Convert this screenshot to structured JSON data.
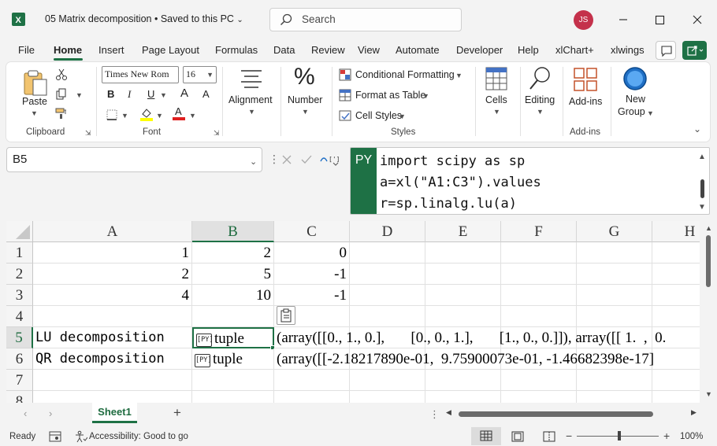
{
  "titlebar": {
    "doc_title": "05 Matrix decomposition",
    "save_status": "Saved to this PC",
    "search_placeholder": "Search",
    "user_initials": "JS"
  },
  "menu": {
    "tabs": [
      "File",
      "Home",
      "Insert",
      "Page Layout",
      "Formulas",
      "Data",
      "Review",
      "View",
      "Automate",
      "Developer",
      "Help",
      "xlChart+",
      "xlwings"
    ],
    "active_tab": "Home"
  },
  "ribbon": {
    "clipboard": {
      "paste": "Paste",
      "label": "Clipboard"
    },
    "font": {
      "font_name": "Times New Rom",
      "font_size": "16",
      "bold": "B",
      "italic": "I",
      "underline": "U",
      "grow": "A",
      "shrink": "A",
      "font_color_letter": "A",
      "label": "Font"
    },
    "alignment": {
      "label": "Alignment"
    },
    "number": {
      "label": "Number"
    },
    "styles": {
      "conditional": "Conditional Formatting",
      "format_table": "Format as Table",
      "cell_styles": "Cell Styles",
      "label": "Styles"
    },
    "cells": {
      "label": "Cells"
    },
    "editing": {
      "label": "Editing"
    },
    "addins": {
      "button": "Add-ins",
      "label": "Add-ins"
    },
    "newgroup": {
      "line1": "New",
      "line2": "Group"
    }
  },
  "formula_bar": {
    "name_box": "B5",
    "mode_badge": "PY",
    "code": [
      "import scipy as sp",
      "a=xl(\"A1:C3\").values",
      "r=sp.linalg.lu(a)"
    ]
  },
  "grid": {
    "columns": [
      "A",
      "B",
      "C",
      "D",
      "E",
      "F",
      "G",
      "H"
    ],
    "selected_column": "B",
    "rows": [
      "1",
      "2",
      "3",
      "4",
      "5",
      "6",
      "7",
      "8"
    ],
    "selected_row": "5",
    "cells": {
      "A1": "1",
      "B1": "2",
      "C1": "0",
      "A2": "2",
      "B2": "5",
      "C2": "-1",
      "A3": "4",
      "B3": "10",
      "C3": "-1",
      "A5": "LU decomposition",
      "B5": "tuple",
      "C5": "(array([[0., 1., 0.],       [0., 0., 1.],       [1., 0., 0.]]), array([[ 1.  ,  0.",
      "A6": "QR decomposition",
      "B6": "tuple",
      "C6": "(array([[-2.18217890e-01,  9.75900073e-01, -1.46682398e-17]"
    },
    "py_icon_text": "[PY]"
  },
  "sheets": {
    "tabs": [
      "Sheet1"
    ],
    "active": "Sheet1"
  },
  "status": {
    "ready": "Ready",
    "accessibility": "Accessibility: Good to go",
    "zoom": "100%"
  },
  "colors": {
    "accent": "#1e7145",
    "avatar": "#c4314b"
  }
}
